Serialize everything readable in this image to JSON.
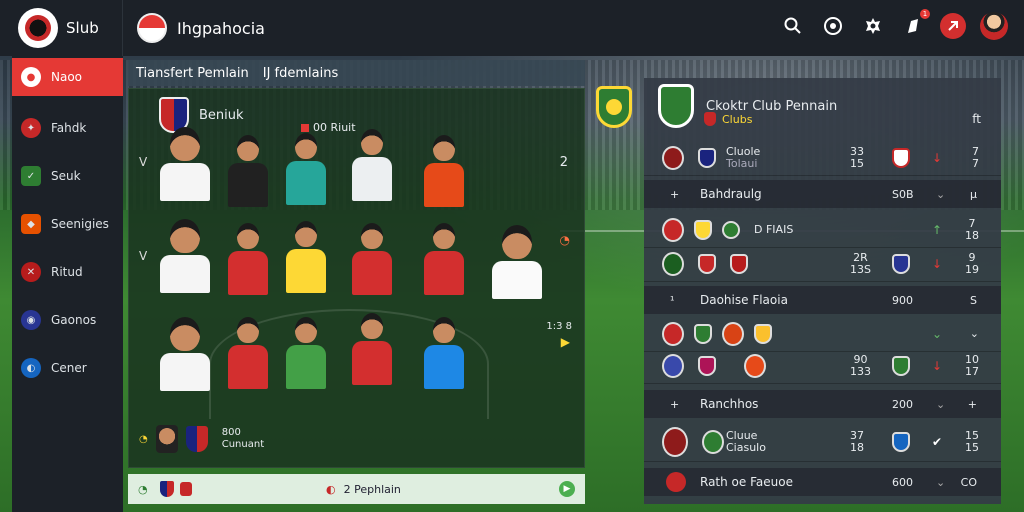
{
  "app": {
    "brand_name": "Slub",
    "title": "Ihgpahocia"
  },
  "topbar": {
    "icons": [
      "search-icon",
      "compass-icon",
      "settings-icon",
      "notification-icon",
      "red-badge-icon",
      "avatar"
    ],
    "notification_count": "1"
  },
  "sidebar": {
    "items": [
      {
        "label": "Naoo",
        "icon": "home-icon",
        "active": true
      },
      {
        "label": "Fahdk",
        "icon": "team-icon",
        "active": false
      },
      {
        "label": "Seuk",
        "icon": "shield-icon",
        "active": false
      },
      {
        "label": "Seenigies",
        "icon": "strategy-icon",
        "active": false
      },
      {
        "label": "Ritud",
        "icon": "kit-icon",
        "active": false
      },
      {
        "label": "Gaonos",
        "icon": "globe-icon",
        "active": false
      },
      {
        "label": "Cener",
        "icon": "center-icon",
        "active": false
      }
    ]
  },
  "transfer_bar": {
    "left": "Tiansfert Pemlain",
    "right": "IJ fdemlains"
  },
  "lineup": {
    "team_label": "Beniuk",
    "mid_label": "00 Riuit",
    "row_numbers": [
      "2"
    ],
    "row_side_mark": "V",
    "rating": "1:3 8",
    "bench": {
      "line1": "800",
      "line2": "Cunuant"
    }
  },
  "footer_bar": {
    "center_label": "2 Pephlain"
  },
  "right_panel": {
    "title": "Ckoktr Club Pennain",
    "subtitle": "Clubs",
    "sub_end": "ft",
    "sections": [
      {
        "label": "Bahdraulg",
        "icon": "+",
        "value": "S0B",
        "end": "µ"
      },
      {
        "label": "Daohise Flaoia",
        "icon": "¹",
        "value": "900",
        "end": "S"
      },
      {
        "label": "Ranchhos",
        "icon": "+",
        "value": "200",
        "end": "+"
      },
      {
        "label": "Rath oe Faeuoe",
        "icon": "",
        "value": "600",
        "end": "CO"
      }
    ],
    "rows": [
      {
        "text1": "Cluole",
        "text2": "Tolaui",
        "num1": "33",
        "num2": "15",
        "arrow": "↓",
        "end1": "7",
        "end2": "7"
      },
      {
        "text1": "D",
        "text2": "FIAIS",
        "num1": "",
        "num2": "",
        "arrow": "↑",
        "end1": "7",
        "end2": "18"
      },
      {
        "text1": "",
        "text2": "",
        "num1": "2R",
        "num2": "13S",
        "arrow": "↓",
        "end1": "9",
        "end2": "19"
      },
      {
        "text1": "",
        "text2": "",
        "num1": "",
        "num2": "",
        "arrow": "↓",
        "end1": "",
        "end2": ""
      },
      {
        "text1": "",
        "text2": "",
        "num1": "90",
        "num2": "133",
        "arrow": "↓",
        "end1": "10",
        "end2": "17"
      },
      {
        "text1": "Cluue",
        "text2": "Ciasulo",
        "num1": "37",
        "num2": "18",
        "arrow": "↓",
        "end1": "15",
        "end2": "15"
      }
    ]
  },
  "colors": {
    "accent": "#e53935",
    "panel": "#343c46",
    "topbar": "#1c2128",
    "pitch": "#3f8a33",
    "highlight": "#fdd835"
  }
}
